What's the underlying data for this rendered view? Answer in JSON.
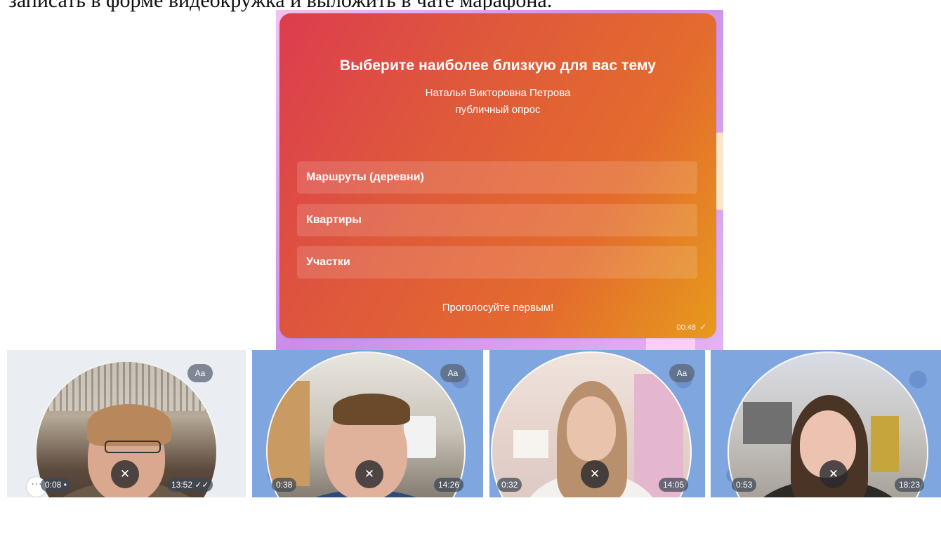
{
  "document": {
    "top_line": "записать в форме видеокружка и выложить в чате марафона."
  },
  "poll": {
    "title": "Выберите наиболее близкую для вас тему",
    "author": "Наталья Викторовна Петрова",
    "type_label": "публичный опрос",
    "options": [
      {
        "label": "Маршруты (деревни)"
      },
      {
        "label": "Квартиры"
      },
      {
        "label": "Участки"
      }
    ],
    "vote_prompt": "Проголосуйте первым!",
    "time": "00:48"
  },
  "video_messages": [
    {
      "duration": "0:08",
      "time": "13:52",
      "font_button": "Aa",
      "background": "#eaedf1"
    },
    {
      "duration": "0:38",
      "time": "14:26",
      "font_button": "Aa",
      "background": "#7fa6de"
    },
    {
      "duration": "0:32",
      "time": "14:05",
      "font_button": "Aa",
      "background": "#7fa6de"
    },
    {
      "duration": "0:53",
      "time": "18:23",
      "background": "#7fa6de"
    }
  ],
  "colors": {
    "poll_gradient_start": "#dc3d4e",
    "poll_gradient_end": "#e69a1c",
    "chat_background_blue": "#7fa6de"
  },
  "icons": {
    "mute": "mute-icon",
    "read_receipt": "double-check-icon",
    "sent": "check-icon",
    "more": "more-icon"
  }
}
